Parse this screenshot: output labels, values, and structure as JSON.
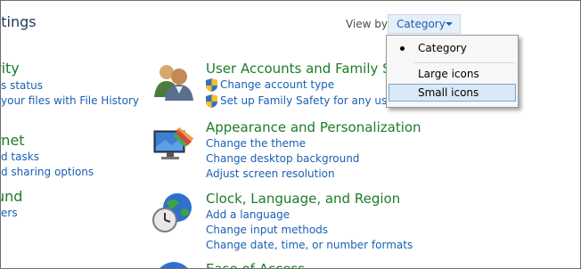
{
  "header": {
    "title": "ttings",
    "view_by_label": "View by:",
    "view_by_value": "Category"
  },
  "dropdown": {
    "items": [
      {
        "label": "Category",
        "selected": true
      },
      {
        "label": "Large icons",
        "selected": false
      },
      {
        "label": "Small icons",
        "highlighted": true
      }
    ]
  },
  "left_column": [
    {
      "heading": "rity",
      "links": [
        "s status",
        "your files with File History"
      ]
    },
    {
      "heading": "rnet",
      "links": [
        "d tasks",
        "d sharing options"
      ]
    },
    {
      "heading": "und",
      "links": [
        "ers"
      ]
    }
  ],
  "categories": [
    {
      "heading": "User Accounts and Family Safe",
      "links": [
        "Change account type",
        "Set up Family Safety for any user"
      ],
      "icon": "users-icon"
    },
    {
      "heading": "Appearance and Personalization",
      "links": [
        "Change the theme",
        "Change desktop background",
        "Adjust screen resolution"
      ],
      "icon": "display-icon"
    },
    {
      "heading": "Clock, Language, and Region",
      "links": [
        "Add a language",
        "Change input methods",
        "Change date, time, or number formats"
      ],
      "icon": "clock-globe-icon"
    },
    {
      "heading": "Ease of Access",
      "links": [],
      "icon": "ease-of-access-icon"
    }
  ]
}
